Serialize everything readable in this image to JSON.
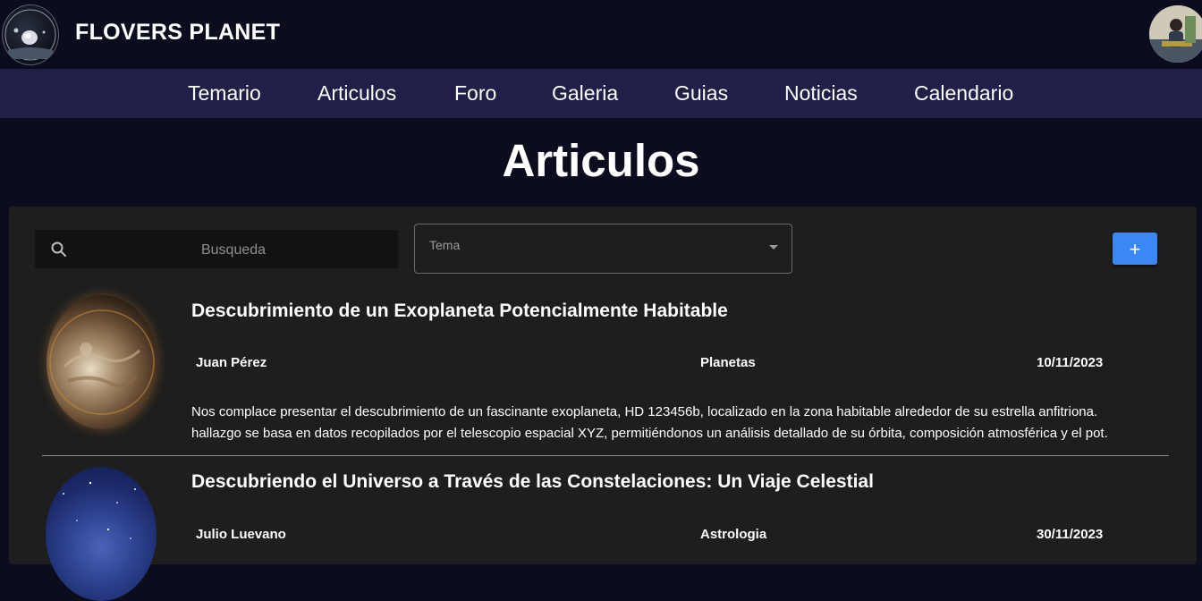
{
  "header": {
    "brand": "FLOVERS PLANET",
    "logo_icon": "planet-logo-icon",
    "avatar_icon": "user-avatar-icon"
  },
  "nav": {
    "items": [
      {
        "label": "Temario"
      },
      {
        "label": "Articulos"
      },
      {
        "label": "Foro"
      },
      {
        "label": "Galeria"
      },
      {
        "label": "Guias"
      },
      {
        "label": "Noticias"
      },
      {
        "label": "Calendario"
      }
    ]
  },
  "page": {
    "title": "Articulos"
  },
  "filters": {
    "search_placeholder": "Busqueda",
    "search_value": "",
    "topic_label": "Tema",
    "add_label": "+"
  },
  "articles": [
    {
      "title": "Descubrimiento de un Exoplaneta Potencialmente Habitable",
      "author": "Juan Pérez",
      "topic": "Planetas",
      "date": "10/11/2023",
      "excerpt_line1": "Nos complace presentar el descubrimiento de un fascinante exoplaneta, HD 123456b, localizado en la zona habitable alrededor de su estrella anfitriona.",
      "excerpt_line2": "hallazgo se basa en datos recopilados por el telescopio espacial XYZ, permitiéndonos un análisis detallado de su órbita, composición atmosférica y el pot."
    },
    {
      "title": "Descubriendo el Universo a Través de las Constelaciones: Un Viaje Celestial",
      "author": "Julio Luevano",
      "topic": "Astrologia",
      "date": "30/11/2023"
    }
  ],
  "colors": {
    "background": "#0b0c1e",
    "navbar": "#1f1f48",
    "panel": "#1e1e1e",
    "accent": "#3a87f5"
  }
}
